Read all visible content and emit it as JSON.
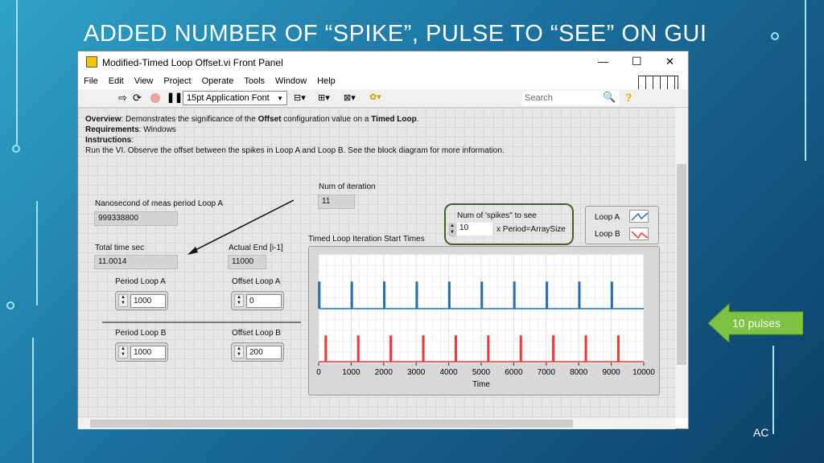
{
  "slide": {
    "title": "ADDED NUMBER OF “SPIKE”, PULSE TO “SEE” ON GUI",
    "footer": "AC",
    "callout": "10 pulses"
  },
  "window": {
    "title": "Modified-Timed Loop Offset.vi Front Panel",
    "minimize": "—",
    "maximize": "☐",
    "close": "✕"
  },
  "menu": [
    "File",
    "Edit",
    "View",
    "Project",
    "Operate",
    "Tools",
    "Window",
    "Help"
  ],
  "toolbar": {
    "font": "15pt Application Font",
    "search_placeholder": "Search",
    "help": "?"
  },
  "description": {
    "overview_label": "Overview",
    "overview_text": ": Demonstrates the significance of the ",
    "offset": "Offset",
    "mid": " configuration value on a ",
    "timed_loop": "Timed Loop",
    "end": ".",
    "req_label": "Requirements",
    "req_text": ": Windows",
    "instr_label": "Instructions",
    "instr_colon": ":",
    "instr_text": "Run the VI. Observe the offset between the spikes in Loop A and Loop B. See the block diagram for more information."
  },
  "indicators": {
    "ns_label": "Nanosecond of meas period Loop A",
    "ns_value": "999338800",
    "total_label": "Total time sec",
    "total_value": "11.0014",
    "actual_label": "Actual End [i-1]",
    "actual_value": "11000",
    "iter_label": "Num of iteration",
    "iter_value": "11"
  },
  "controls": {
    "period_a_label": "Period Loop A",
    "period_a": "1000",
    "offset_a_label": "Offset Loop A",
    "offset_a": "0",
    "period_b_label": "Period Loop B",
    "period_b": "1000",
    "offset_b_label": "Offset Loop B",
    "offset_b": "200",
    "spikes_label": "Num of 'spikes\" to see",
    "spikes": "10",
    "spikes_suffix": "x Period=ArraySize"
  },
  "chart_data": {
    "type": "line",
    "title": "Timed Loop Iteration Start Times",
    "xlabel": "Time",
    "xlim": [
      0,
      10000
    ],
    "xticks": [
      "0",
      "1000",
      "2000",
      "3000",
      "4000",
      "5000",
      "6000",
      "7000",
      "8000",
      "9000",
      "10000"
    ],
    "legend": [
      "Loop A",
      "Loop B"
    ],
    "series": [
      {
        "name": "Loop A",
        "color": "#2a6fb0",
        "spikes": [
          0,
          1000,
          2000,
          3000,
          4000,
          5000,
          6000,
          7000,
          8000,
          9000
        ]
      },
      {
        "name": "Loop B",
        "color": "#f03a3a",
        "spikes": [
          200,
          1200,
          2200,
          3200,
          4200,
          5200,
          6200,
          7200,
          8200,
          9200
        ]
      }
    ]
  }
}
